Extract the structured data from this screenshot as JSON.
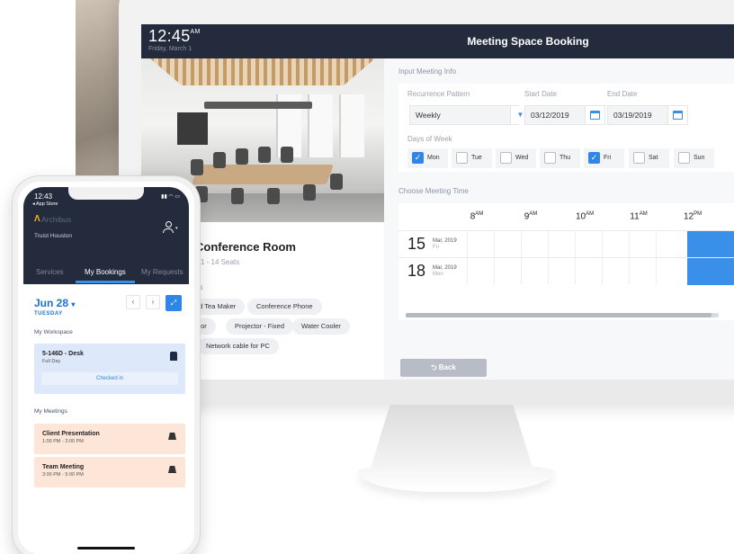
{
  "desktop": {
    "clock": "12:45",
    "clock_ampm": "AM",
    "date": "Friday, March 1",
    "title": "Meeting Space Booking",
    "room": {
      "name": "Conference Room",
      "seats": "1 - 14 Seats",
      "amenities_label": "es",
      "amenities": [
        "nd Tea Maker",
        "Conference Phone",
        "onitor",
        "Projector - Fixed",
        "Water Cooler",
        "Network cable for PC"
      ]
    },
    "form": {
      "input_section": "Input Meeting Info",
      "recurrence_label": "Recurrence Pattern",
      "recurrence_value": "Weekly",
      "start_label": "Start Date",
      "start_value": "03/12/2019",
      "end_label": "End Date",
      "end_value": "03/19/2019",
      "days_label": "Days of Week",
      "days": [
        {
          "label": "Mon",
          "checked": true
        },
        {
          "label": "Tue",
          "checked": false
        },
        {
          "label": "Wed",
          "checked": false
        },
        {
          "label": "Thu",
          "checked": false
        },
        {
          "label": "Fri",
          "checked": true
        },
        {
          "label": "Sat",
          "checked": false
        },
        {
          "label": "Sun",
          "checked": false
        }
      ],
      "time_section": "Choose Meeting Time",
      "hours": [
        {
          "num": "8",
          "ampm": "AM"
        },
        {
          "num": "9",
          "ampm": "AM"
        },
        {
          "num": "10",
          "ampm": "AM"
        },
        {
          "num": "11",
          "ampm": "AM"
        },
        {
          "num": "12",
          "ampm": "PM"
        }
      ],
      "rows": [
        {
          "day": "15",
          "month_year": "Mar, 2019",
          "weekday": "Fri"
        },
        {
          "day": "18",
          "month_year": "Mar, 2019",
          "weekday": "Mon"
        }
      ],
      "back_label": "Back"
    }
  },
  "phone": {
    "time": "12:43",
    "store": "◂ App Store",
    "logo": "Archibus",
    "site": "Truist Houston",
    "tabs": [
      {
        "label": "Services",
        "active": false
      },
      {
        "label": "My Bookings",
        "active": true
      },
      {
        "label": "My Requests",
        "active": false
      }
    ],
    "date": "Jun 28",
    "weekday": "TUESDAY",
    "workspace_label": "My Workspace",
    "workspace": {
      "name": "5-146D - Desk",
      "sub": "Full Day",
      "status": "Checked in"
    },
    "meetings_label": "My Meetings",
    "meetings": [
      {
        "name": "Client Presentation",
        "time": "1:00 PM - 2:00 PM"
      },
      {
        "name": "Team Meeting",
        "time": "3:00 PM - 5:00 PM"
      }
    ]
  },
  "colors": {
    "navbar": "#232b3d",
    "accent": "#3a8fe8",
    "workspace_card": "#dde9fb",
    "meeting_card": "#fde6d8"
  },
  "icons": [
    "calendar-icon",
    "chevron-down-icon",
    "check-icon",
    "back-arrow-icon",
    "user-icon",
    "chair-icon",
    "meeting-room-icon",
    "expand-icon"
  ]
}
